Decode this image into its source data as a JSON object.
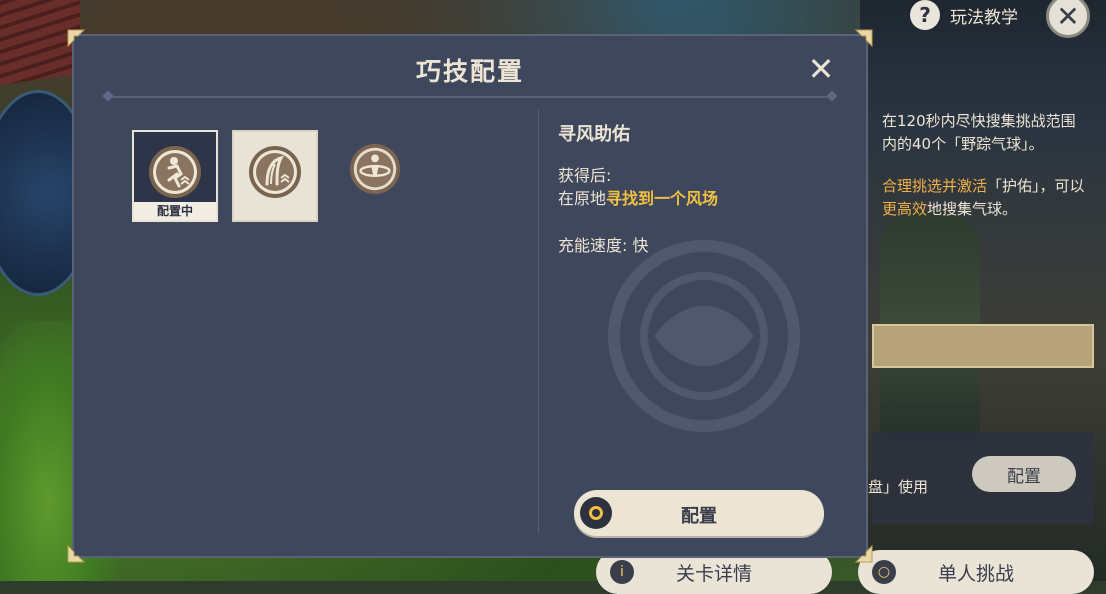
{
  "header": {
    "help_icon_glyph": "?",
    "help_label": "玩法教学",
    "close_glyph": "✕"
  },
  "right_panel": {
    "desc_line1": "在120秒内尽快搜集挑战范围",
    "desc_line2": "内的40个「野踪气球」。",
    "tip_part1": "合理挑选并激活",
    "tip_part2": "「护佑」，可以",
    "tip_part3": "更高效",
    "tip_part4": "地搜集气球。",
    "usage_text": "盘」使用",
    "config_label": "配置",
    "stage_details_label": "关卡详情",
    "stage_details_icon": "i",
    "solo_challenge_label": "单人挑战",
    "solo_challenge_icon": "○"
  },
  "modal": {
    "title": "巧技配置",
    "close_glyph": "✕",
    "slots": [
      {
        "icon": "runner-icon",
        "badge": "配置中",
        "state": "active"
      },
      {
        "icon": "wind-feather-icon",
        "badge": "",
        "state": "selected"
      },
      {
        "icon": "spin-figure-icon",
        "badge": "",
        "state": "normal"
      }
    ],
    "detail": {
      "name": "寻风助佑",
      "after_label": "获得后:",
      "effect_prefix": "在原地",
      "effect_highlight": "寻找到一个风场",
      "charge_label": "充能速度: 快"
    },
    "config_button_label": "配置"
  },
  "colors": {
    "modal_bg": "#3f475c",
    "accent_yellow": "#f0c040",
    "accent_orange": "#f0b04a",
    "text_light": "#ece5d4"
  }
}
